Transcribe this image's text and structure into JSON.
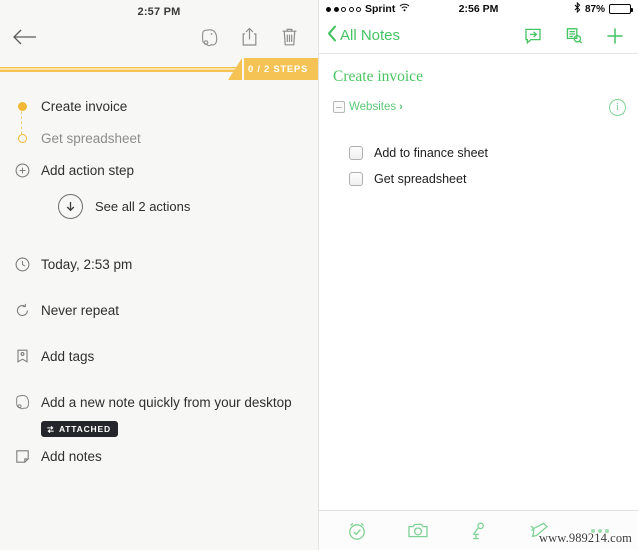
{
  "left_panel": {
    "clock": "2:57 PM",
    "toolbar": {
      "back_icon": "back-arrow-icon",
      "evernote_icon": "evernote-elephant-icon",
      "share_icon": "share-icon",
      "delete_icon": "trash-icon"
    },
    "progress": {
      "steps_label": "0 / 2 STEPS",
      "completed": 0,
      "total": 2,
      "accent_color": "#f5c353"
    },
    "steps": [
      {
        "label": "Create invoice",
        "state": "current",
        "bullet": "filled-dot"
      },
      {
        "label": "Get spreadsheet",
        "state": "pending",
        "bullet": "hollow-dot"
      }
    ],
    "add_action": {
      "label": "Add action step",
      "icon": "plus-circle-icon"
    },
    "see_all": {
      "label": "See all 2 actions",
      "icon": "arrow-down-circle-icon"
    },
    "details": [
      {
        "label": "Today, 2:53 pm",
        "icon": "clock-icon"
      },
      {
        "label": "Never repeat",
        "icon": "repeat-icon"
      },
      {
        "label": "Add tags",
        "icon": "tag-icon"
      },
      {
        "label": "Add a new note quickly from your desktop",
        "icon": "evernote-elephant-icon",
        "badge": "ATTACHED",
        "badge_icon": "sync-icon"
      },
      {
        "label": "Add notes",
        "icon": "note-icon"
      }
    ]
  },
  "right_panel": {
    "status_bar": {
      "carrier": "Sprint",
      "signal_filled": 2,
      "signal_total": 5,
      "wifi_icon": "wifi-icon",
      "time": "2:56 PM",
      "bluetooth_icon": "bluetooth-icon",
      "battery_percent": "87%",
      "battery_level": 87
    },
    "nav_bar": {
      "back_label": "All Notes",
      "back_icon": "chevron-left-icon",
      "share_icon": "share-arrow-icon",
      "search_icon": "search-document-icon",
      "add_icon": "plus-icon",
      "accent_color": "#45c463"
    },
    "note": {
      "title": "Create invoice",
      "notebook": "Websites",
      "notebook_icon": "notebook-icon",
      "notebook_chevron": "›",
      "info_icon": "info-icon",
      "info_glyph": "i",
      "checklist": [
        {
          "label": "Add to finance sheet",
          "checked": false
        },
        {
          "label": "Get spreadsheet",
          "checked": false
        }
      ]
    },
    "toolbar": [
      {
        "icon": "reminder-alarm-icon"
      },
      {
        "icon": "camera-icon"
      },
      {
        "icon": "microphone-icon"
      },
      {
        "icon": "pen-draw-icon"
      },
      {
        "icon": "more-dots-icon"
      }
    ],
    "watermark": "www.989214.com"
  }
}
